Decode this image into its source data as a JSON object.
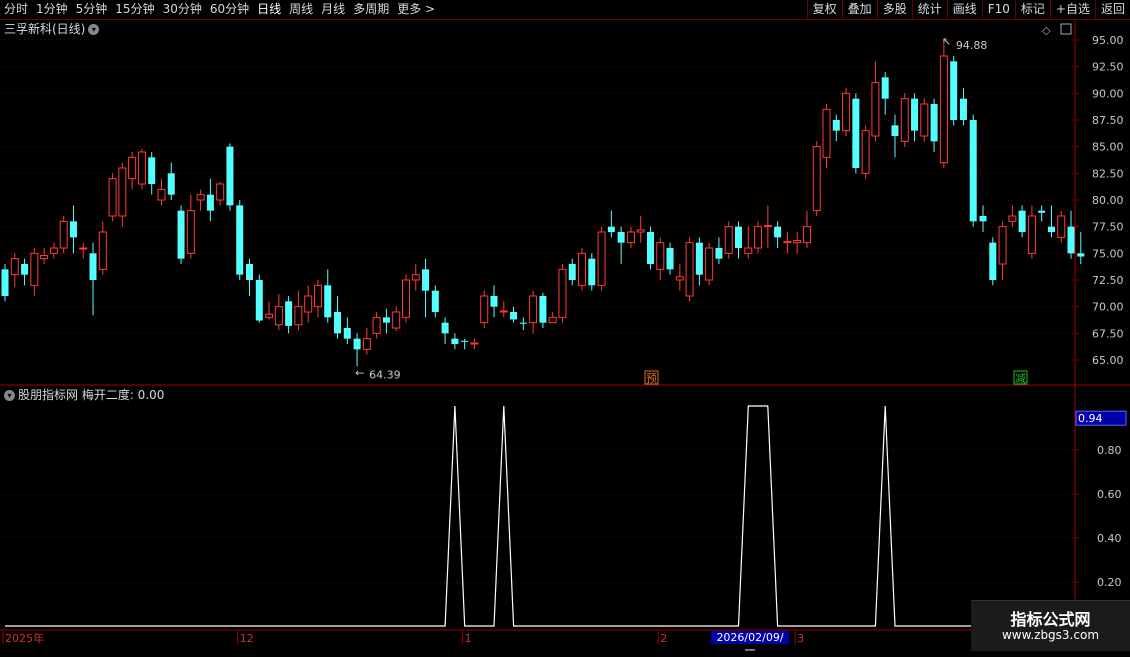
{
  "toolbar": {
    "left_items": [
      "分时",
      "1分钟",
      "5分钟",
      "15分钟",
      "30分钟",
      "60分钟",
      "日线",
      "周线",
      "月线",
      "多周期",
      "更多 >"
    ],
    "active": "日线",
    "right_items": [
      "复权",
      "叠加",
      "多股",
      "统计",
      "画线",
      "F10",
      "标记",
      "+自选",
      "返回"
    ]
  },
  "main_panel": {
    "title": "三孚新科(日线)",
    "high_label": "94.88",
    "low_label": "64.39",
    "y_ticks": [
      "95.00",
      "92.50",
      "90.00",
      "87.50",
      "85.00",
      "82.50",
      "80.00",
      "77.50",
      "75.00",
      "72.50",
      "70.00",
      "67.50",
      "65.00"
    ],
    "markers": [
      {
        "text": "预",
        "color": "#e07020"
      },
      {
        "text": "减",
        "color": "#20c020"
      }
    ]
  },
  "indicator_panel": {
    "title": "股朋指标网 梅开二度: 0.00",
    "current_value": "0.94",
    "y_ticks": [
      "0.80",
      "0.60",
      "0.40",
      "0.20"
    ]
  },
  "date_axis": {
    "labels": [
      "2025年",
      "12",
      "1",
      "2",
      "3"
    ],
    "selected_date": "2026/02/09/一"
  },
  "watermark": {
    "line1": "指标公式网",
    "line2": "www.zbgs3.com"
  },
  "colors": {
    "up": "#ff3b3b",
    "down": "#54ffff",
    "grid": "#7a0000",
    "indicator_line": "#ffffff"
  },
  "chart_data": {
    "type": "candlestick",
    "ylim": [
      63.5,
      96.0
    ],
    "candles": [
      [
        73.5,
        71.0,
        74.0,
        70.5
      ],
      [
        73.0,
        74.5,
        75.0,
        71.8
      ],
      [
        74.0,
        73.0,
        74.5,
        72.0
      ],
      [
        72.0,
        75.0,
        75.5,
        71.0
      ],
      [
        74.5,
        74.8,
        75.5,
        74.0
      ],
      [
        75.0,
        75.5,
        76.0,
        74.5
      ],
      [
        75.5,
        78.0,
        78.5,
        75.0
      ],
      [
        78.0,
        76.5,
        79.5,
        75.0
      ],
      [
        75.5,
        75.5,
        76.0,
        74.5
      ],
      [
        75.0,
        72.5,
        76.0,
        69.2
      ],
      [
        73.5,
        77.0,
        78.0,
        73.0
      ],
      [
        78.5,
        82.0,
        82.5,
        78.0
      ],
      [
        78.5,
        83.0,
        83.5,
        77.5
      ],
      [
        82.0,
        84.0,
        84.5,
        81.0
      ],
      [
        81.5,
        84.5,
        84.8,
        81.0
      ],
      [
        84.0,
        81.5,
        84.5,
        80.5
      ],
      [
        80.0,
        81.0,
        82.0,
        79.5
      ],
      [
        82.5,
        80.5,
        83.5,
        80.0
      ],
      [
        79.0,
        74.5,
        79.5,
        74.0
      ],
      [
        75.0,
        79.0,
        80.5,
        74.5
      ],
      [
        80.0,
        80.5,
        81.0,
        79.0
      ],
      [
        80.5,
        79.0,
        82.0,
        78.0
      ],
      [
        80.0,
        81.5,
        81.7,
        79.5
      ],
      [
        85.0,
        79.5,
        85.3,
        79.0
      ],
      [
        79.5,
        73.0,
        80.0,
        72.5
      ],
      [
        74.0,
        72.5,
        74.5,
        71.0
      ],
      [
        72.5,
        68.7,
        73.0,
        68.5
      ],
      [
        69.0,
        69.3,
        70.5,
        68.8
      ],
      [
        68.3,
        70.0,
        71.2,
        67.8
      ],
      [
        70.5,
        68.2,
        71.0,
        67.5
      ],
      [
        68.3,
        70.0,
        71.5,
        67.8
      ],
      [
        69.5,
        71.0,
        72.0,
        68.5
      ],
      [
        70.0,
        72.0,
        72.5,
        69.0
      ],
      [
        72.0,
        69.0,
        73.5,
        68.5
      ],
      [
        69.5,
        67.5,
        71.0,
        67.0
      ],
      [
        68.0,
        67.0,
        69.0,
        66.5
      ],
      [
        67.0,
        66.0,
        67.5,
        64.4
      ],
      [
        66.0,
        67.0,
        68.0,
        65.5
      ],
      [
        67.5,
        69.0,
        69.5,
        67.0
      ],
      [
        69.0,
        68.5,
        69.8,
        67.5
      ],
      [
        68.0,
        69.5,
        70.0,
        67.7
      ],
      [
        69.0,
        72.5,
        73.0,
        68.5
      ],
      [
        72.5,
        73.0,
        74.0,
        71.5
      ],
      [
        73.5,
        71.5,
        74.5,
        69.0
      ],
      [
        71.5,
        69.5,
        72.0,
        69.0
      ],
      [
        68.5,
        67.5,
        69.0,
        66.5
      ],
      [
        67.0,
        66.5,
        67.5,
        66.0
      ],
      [
        66.8,
        66.7,
        67.0,
        66.0
      ],
      [
        66.5,
        66.6,
        67.0,
        66.0
      ],
      [
        68.5,
        71.0,
        71.5,
        68.0
      ],
      [
        71.0,
        70.0,
        72.0,
        69.0
      ],
      [
        69.5,
        69.6,
        70.5,
        69.0
      ],
      [
        69.5,
        68.8,
        70.0,
        68.5
      ],
      [
        68.5,
        68.4,
        69.0,
        67.8
      ],
      [
        68.5,
        71.0,
        71.5,
        67.5
      ],
      [
        71.0,
        68.5,
        71.3,
        68.0
      ],
      [
        68.5,
        69.0,
        69.5,
        68.5
      ],
      [
        69.0,
        73.5,
        74.0,
        68.5
      ],
      [
        74.0,
        72.5,
        74.5,
        72.0
      ],
      [
        72.0,
        75.0,
        75.5,
        71.5
      ],
      [
        74.5,
        72.0,
        75.0,
        71.5
      ],
      [
        72.0,
        77.0,
        77.5,
        71.5
      ],
      [
        77.5,
        77.0,
        79.0,
        76.5
      ],
      [
        77.0,
        76.0,
        77.5,
        74.0
      ],
      [
        76.0,
        77.0,
        77.5,
        75.5
      ],
      [
        77.0,
        77.2,
        78.5,
        76.0
      ],
      [
        77.0,
        74.0,
        77.5,
        73.5
      ],
      [
        73.5,
        76.0,
        76.5,
        72.5
      ],
      [
        75.5,
        73.5,
        76.0,
        73.0
      ],
      [
        72.5,
        72.8,
        74.0,
        71.5
      ],
      [
        71.0,
        76.0,
        76.5,
        70.5
      ],
      [
        76.0,
        73.0,
        76.5,
        72.0
      ],
      [
        72.5,
        75.5,
        76.0,
        72.0
      ],
      [
        75.5,
        74.5,
        76.5,
        74.0
      ],
      [
        75.0,
        77.5,
        78.0,
        74.5
      ],
      [
        77.5,
        75.5,
        78.0,
        74.5
      ],
      [
        75.0,
        75.5,
        77.5,
        74.5
      ],
      [
        75.5,
        77.5,
        78.0,
        75.0
      ],
      [
        77.5,
        77.6,
        79.5,
        75.5
      ],
      [
        77.5,
        76.5,
        78.0,
        75.5
      ],
      [
        76.0,
        76.1,
        77.0,
        75.0
      ],
      [
        76.0,
        76.2,
        77.0,
        75.0
      ],
      [
        76.0,
        77.5,
        79.0,
        75.5
      ],
      [
        79.0,
        85.0,
        85.5,
        78.5
      ],
      [
        84.0,
        88.5,
        89.0,
        83.0
      ],
      [
        87.5,
        86.5,
        88.0,
        85.5
      ],
      [
        86.5,
        90.0,
        90.5,
        86.0
      ],
      [
        89.5,
        83.0,
        90.0,
        82.5
      ],
      [
        82.5,
        86.5,
        87.0,
        82.0
      ],
      [
        86.0,
        91.0,
        93.0,
        85.5
      ],
      [
        91.5,
        89.5,
        92.0,
        88.0
      ],
      [
        87.0,
        86.0,
        88.0,
        84.0
      ],
      [
        85.5,
        89.5,
        90.0,
        85.0
      ],
      [
        89.5,
        86.5,
        90.0,
        85.5
      ],
      [
        86.0,
        89.0,
        89.5,
        85.5
      ],
      [
        89.0,
        85.5,
        89.5,
        84.5
      ],
      [
        83.5,
        93.5,
        94.9,
        83.0
      ],
      [
        93.0,
        87.5,
        93.5,
        87.0
      ],
      [
        89.5,
        87.5,
        90.5,
        87.0
      ],
      [
        87.5,
        78.0,
        88.0,
        77.5
      ],
      [
        78.5,
        78.0,
        79.5,
        77.0
      ],
      [
        76.0,
        72.5,
        76.5,
        72.0
      ],
      [
        74.0,
        77.5,
        78.0,
        72.5
      ],
      [
        78.0,
        78.5,
        79.5,
        77.5
      ],
      [
        79.0,
        77.0,
        79.5,
        76.5
      ],
      [
        75.0,
        78.5,
        79.5,
        74.5
      ],
      [
        79.0,
        78.8,
        79.5,
        78.0
      ],
      [
        77.5,
        77.0,
        79.5,
        76.5
      ],
      [
        76.5,
        78.5,
        79.0,
        76.0
      ],
      [
        77.5,
        75.0,
        79.0,
        74.5
      ],
      [
        75.0,
        74.7,
        77.0,
        74.0
      ]
    ],
    "indicator_values": [
      0,
      0,
      0,
      0,
      0,
      0,
      0,
      0,
      0,
      0,
      0,
      0,
      0,
      0,
      0,
      0,
      0,
      0,
      0,
      0,
      0,
      0,
      0,
      0,
      0,
      0,
      0,
      0,
      0,
      0,
      0,
      0,
      0,
      0,
      0,
      0,
      0,
      0,
      0,
      0,
      0,
      0,
      0,
      0,
      0,
      0,
      1,
      0,
      0,
      0,
      0,
      1,
      0,
      0,
      0,
      0,
      0,
      0,
      0,
      0,
      0,
      0,
      0,
      0,
      0,
      0,
      0,
      0,
      0,
      0,
      0,
      0,
      0,
      0,
      0,
      0,
      1,
      1,
      1,
      0,
      0,
      0,
      0,
      0,
      0,
      0,
      0,
      0,
      0,
      0,
      1,
      0,
      0,
      0,
      0,
      0,
      0,
      0,
      0,
      0,
      0,
      0,
      0,
      0,
      0,
      0,
      0
    ]
  }
}
